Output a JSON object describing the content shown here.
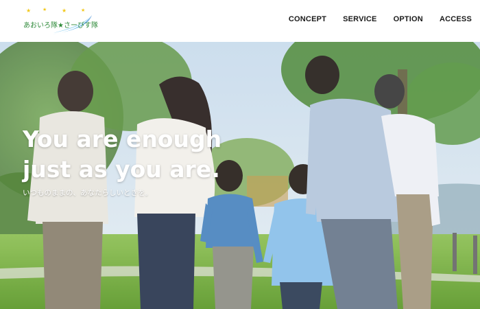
{
  "header": {
    "logo_text": "あおいろ隊★さーびす隊",
    "nav": [
      "CONCEPT",
      "SERVICE",
      "OPTION",
      "ACCESS"
    ]
  },
  "hero": {
    "title_line1": "You are enough",
    "title_line2": "just as you are.",
    "subtitle": "いつものままの、あなたらしいときを。"
  },
  "colors": {
    "nav_text": "#1a1a1a",
    "logo_green": "#2f8a3a",
    "logo_blue": "#3a8fd6",
    "hero_text": "#ffffff"
  }
}
